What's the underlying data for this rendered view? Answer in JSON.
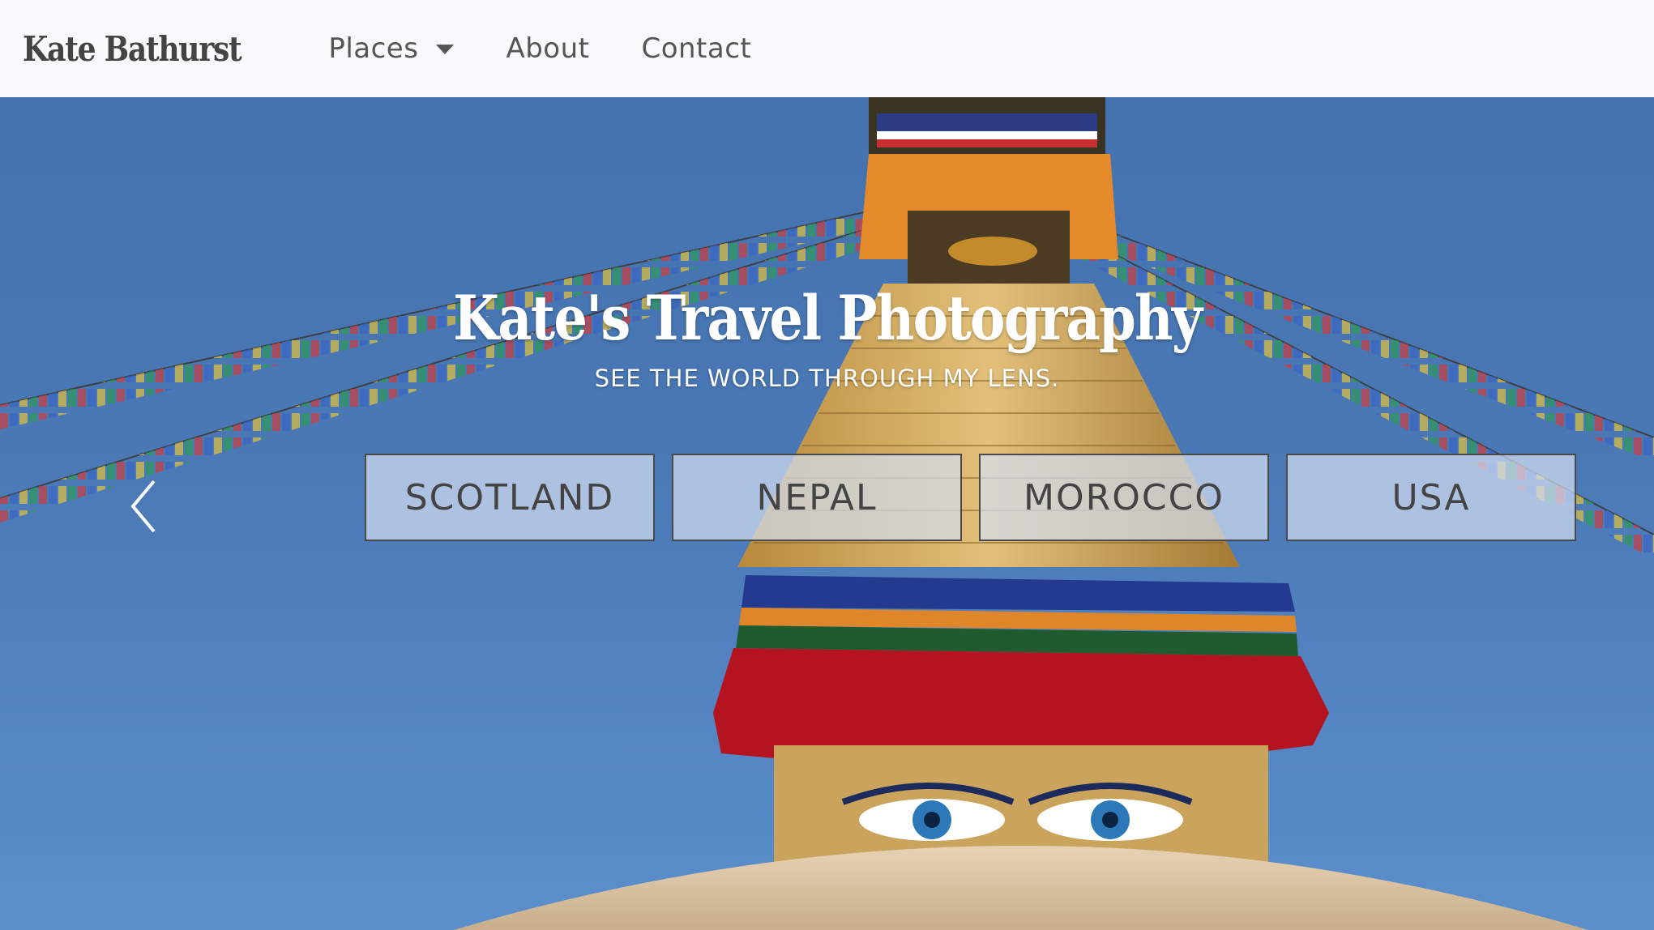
{
  "navbar": {
    "brand": "Kate Bathurst",
    "items": [
      {
        "label": "Places",
        "has_dropdown": true
      },
      {
        "label": "About"
      },
      {
        "label": "Contact"
      }
    ]
  },
  "hero": {
    "title": "Kate's Travel Photography",
    "subtitle": "SEE THE WORLD THROUGH MY LENS.",
    "places": [
      "SCOTLAND",
      "NEPAL",
      "MOROCCO",
      "USA"
    ]
  },
  "colors": {
    "navbar_bg": "#f8f9fa",
    "sky": "#4a79b6",
    "text_dark": "#444444",
    "text_light": "#ffffff"
  },
  "icons": {
    "carousel_prev": "chevron-left-icon",
    "dropdown": "caret-down-icon"
  }
}
